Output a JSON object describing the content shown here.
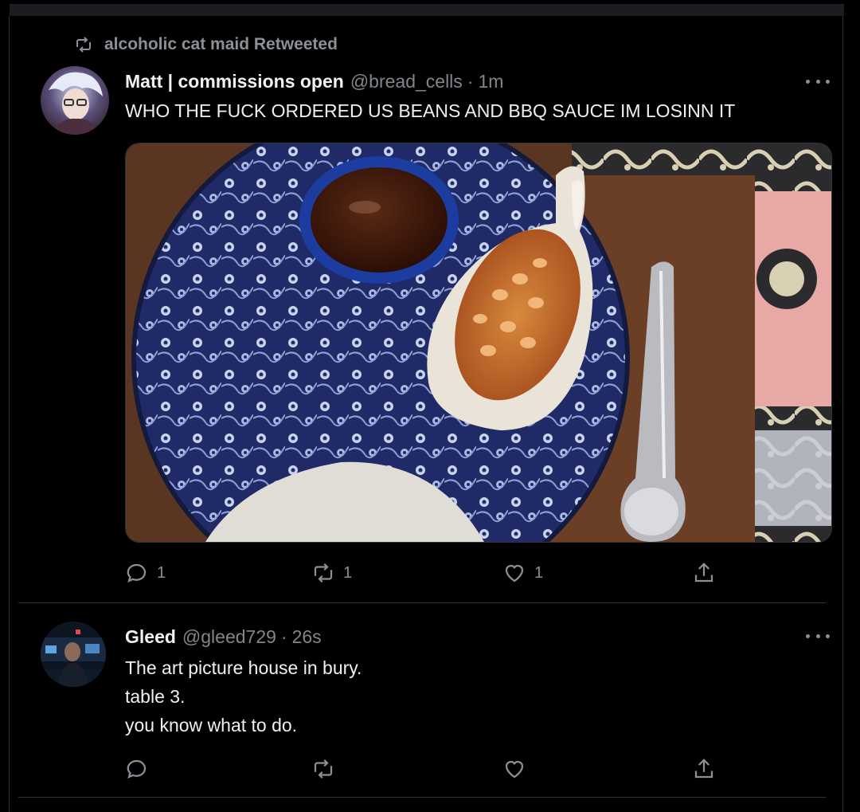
{
  "retweet_banner": {
    "text": "alcoholic cat maid Retweeted",
    "icon": "retweet-icon"
  },
  "tweet1": {
    "name": "Matt | commissions open",
    "handle": "@bread_cells",
    "separator": "·",
    "time": "1m",
    "text": "WHO THE FUCK ORDERED US BEANS AND BBQ SAUCE IM LOSINN IT",
    "replies": "1",
    "retweets": "1",
    "likes": "1"
  },
  "tweet2": {
    "name": "Gleed",
    "handle": "@gleed729",
    "separator": "·",
    "time": "26s",
    "lines": [
      "The art picture house in bury.",
      "table 3.",
      "you know what to do."
    ]
  },
  "icons": {
    "reply": "reply-icon",
    "retweet": "retweet-icon",
    "like": "heart-icon",
    "share": "share-icon",
    "more": "more-icon"
  },
  "colors": {
    "background": "#000000",
    "muted": "#8b9096",
    "text": "#e7e9ea",
    "border": "#2f3336"
  }
}
